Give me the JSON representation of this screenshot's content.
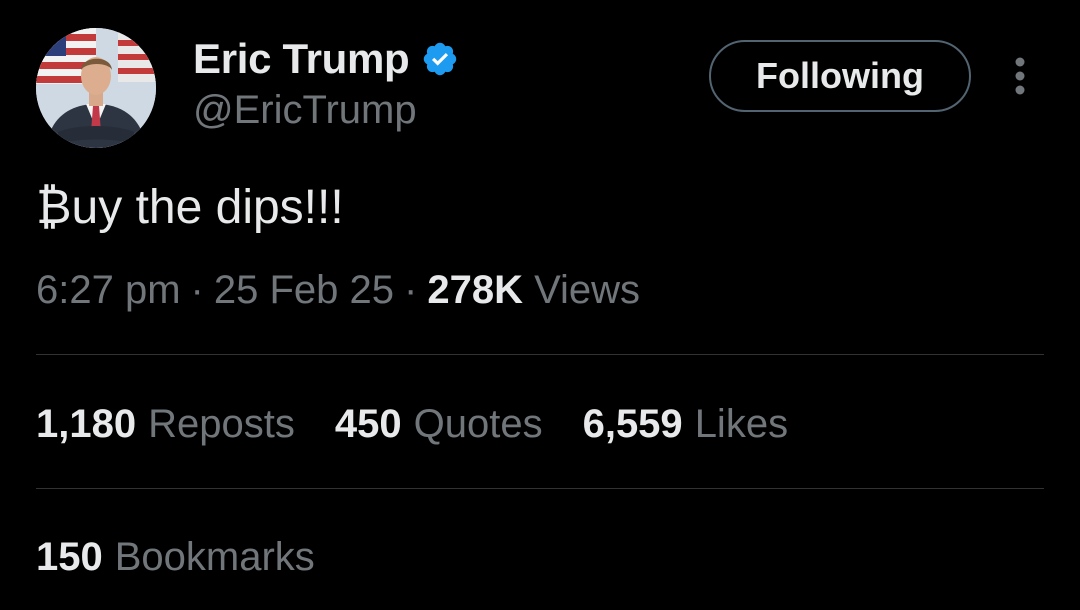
{
  "author": {
    "display_name": "Eric Trump",
    "handle": "@EricTrump",
    "verified_color": "#1d9bf0"
  },
  "actions": {
    "follow_label": "Following",
    "more_icon": "more-vertical-icon"
  },
  "tweet": {
    "text": "₿uy the dips!!!",
    "time": "6:27 pm",
    "separator": "·",
    "date": "25 Feb 25",
    "views_count": "278K",
    "views_label": "Views"
  },
  "stats": {
    "reposts_count": "1,180",
    "reposts_label": "Reposts",
    "quotes_count": "450",
    "quotes_label": "Quotes",
    "likes_count": "6,559",
    "likes_label": "Likes",
    "bookmarks_count": "150",
    "bookmarks_label": "Bookmarks"
  },
  "colors": {
    "background": "#000000",
    "primary_text": "#e7e9ea",
    "secondary_text": "#71767b",
    "divider": "#2f3336",
    "button_border": "#536471"
  }
}
